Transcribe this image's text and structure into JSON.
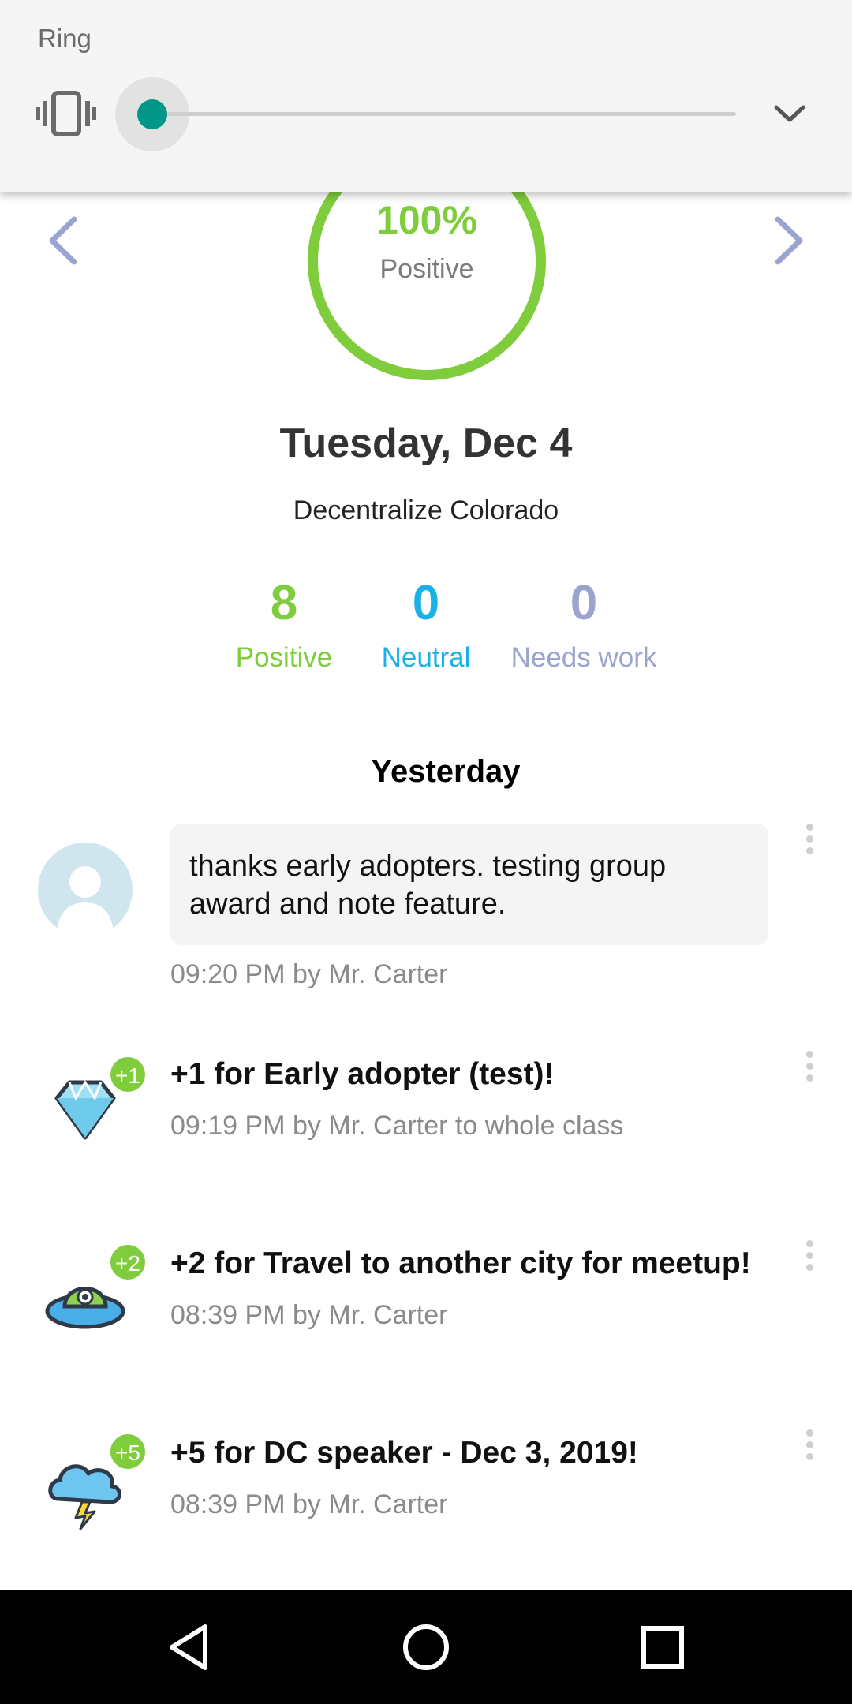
{
  "volume_panel": {
    "title": "Ring",
    "level": 0.0
  },
  "summary": {
    "ring_percent": "100%",
    "ring_label": "Positive",
    "date": "Tuesday, Dec 4",
    "class_name": "Decentralize Colorado",
    "stats": {
      "positive": {
        "value": "8",
        "label": "Positive"
      },
      "neutral": {
        "value": "0",
        "label": "Neutral"
      },
      "needs_work": {
        "value": "0",
        "label": "Needs work"
      }
    }
  },
  "feed": {
    "heading": "Yesterday",
    "note": {
      "text": "thanks early adopters. testing group award and note feature.",
      "meta": "09:20 PM by Mr. Carter"
    },
    "awards": [
      {
        "badge": "+1",
        "title": "+1 for Early adopter (test)!",
        "meta": "09:19 PM by Mr. Carter to whole class",
        "icon": "diamond-icon"
      },
      {
        "badge": "+2",
        "title": "+2 for Travel to another city for meetup!",
        "meta": "08:39 PM by Mr. Carter",
        "icon": "ufo-icon"
      },
      {
        "badge": "+5",
        "title": "+5 for DC speaker - Dec 3, 2019!",
        "meta": "08:39 PM by Mr. Carter",
        "icon": "storm-cloud-icon"
      }
    ]
  },
  "colors": {
    "positive": "#7fcc3c",
    "neutral": "#1ab0e8",
    "needs_work": "#9ba3cf",
    "slider_accent": "#009688"
  }
}
